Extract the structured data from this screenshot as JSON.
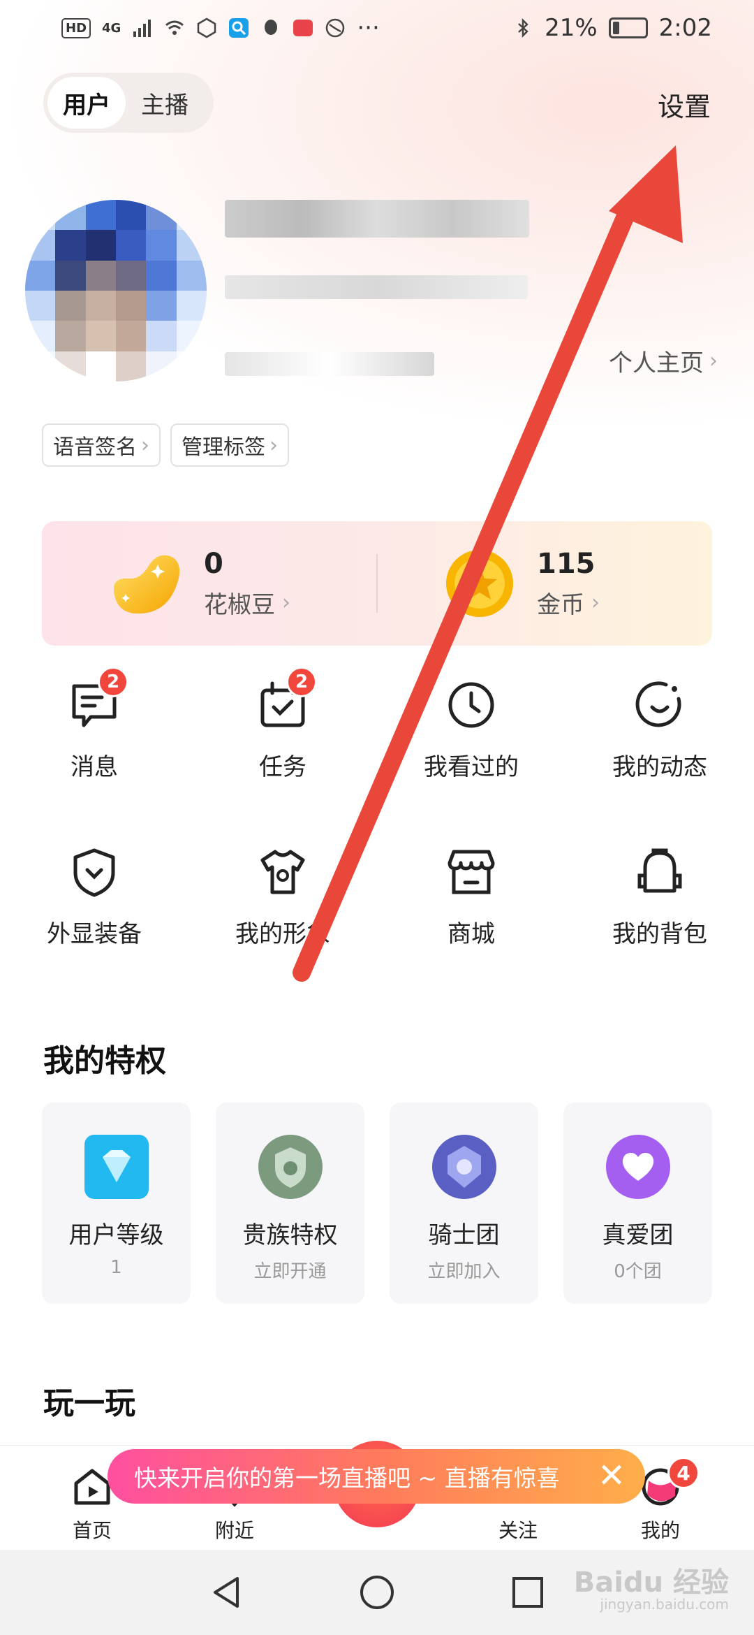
{
  "status_bar": {
    "hd_badge": "HD",
    "network": "4G",
    "battery_text": "21%",
    "battery_level": 0.21,
    "time": "2:02",
    "more": "···"
  },
  "header": {
    "tabs": [
      {
        "label": "用户",
        "active": true
      },
      {
        "label": "主播",
        "active": false
      }
    ],
    "settings_label": "设置"
  },
  "profile": {
    "homepage_label": "个人主页"
  },
  "tags": [
    {
      "label": "语音签名"
    },
    {
      "label": "管理标签"
    }
  ],
  "wallet": {
    "beans": {
      "value": "0",
      "label": "花椒豆"
    },
    "coins": {
      "value": "115",
      "label": "金币"
    }
  },
  "features": [
    {
      "label": "消息",
      "icon": "message-icon",
      "badge": "2"
    },
    {
      "label": "任务",
      "icon": "task-icon",
      "badge": "2"
    },
    {
      "label": "我看过的",
      "icon": "clock-icon",
      "badge": ""
    },
    {
      "label": "我的动态",
      "icon": "moments-icon",
      "badge": ""
    },
    {
      "label": "外显装备",
      "icon": "shield-icon",
      "badge": ""
    },
    {
      "label": "我的形象",
      "icon": "tshirt-icon",
      "badge": ""
    },
    {
      "label": "商城",
      "icon": "store-icon",
      "badge": ""
    },
    {
      "label": "我的背包",
      "icon": "backpack-icon",
      "badge": ""
    }
  ],
  "privileges": {
    "title": "我的特权",
    "items": [
      {
        "name": "用户等级",
        "sub": "1",
        "icon": "diamond-icon"
      },
      {
        "name": "贵族特权",
        "sub": "立即开通",
        "icon": "noble-badge-icon"
      },
      {
        "name": "骑士团",
        "sub": "立即加入",
        "icon": "knight-badge-icon"
      },
      {
        "name": "真爱团",
        "sub": "0个团",
        "icon": "heart-badge-icon"
      }
    ]
  },
  "play": {
    "title": "玩一玩"
  },
  "promo": {
    "text": "快来开启你的第一场直播吧 ~ 直播有惊喜",
    "close": "✕"
  },
  "bottom_nav": [
    {
      "label": "首页",
      "icon": "home-video-icon",
      "badge": ""
    },
    {
      "label": "附近",
      "icon": "location-icon",
      "badge": ""
    },
    {
      "label": "关注",
      "icon": "follow-icon",
      "badge": ""
    },
    {
      "label": "我的",
      "icon": "profile-icon",
      "badge": "4"
    }
  ],
  "watermark": {
    "text": "Baidu 经验",
    "sub": "jingyan.baidu.com"
  },
  "colors": {
    "accent_red": "#f0463c",
    "annotation_arrow": "#e8473a",
    "promo_gradient_start": "#ff4fa0",
    "promo_gradient_end": "#ffae4a"
  }
}
